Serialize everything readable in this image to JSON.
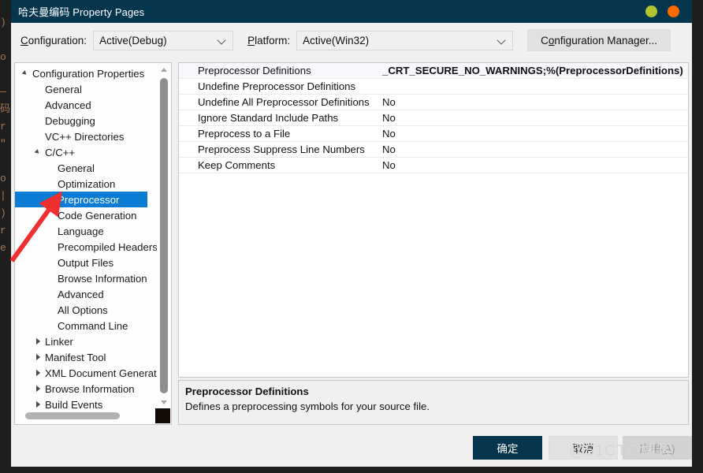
{
  "window": {
    "title": "哈夫曼编码 Property Pages",
    "controls": [
      {
        "name": "minimize-dot",
        "color": "#b3c42e"
      },
      {
        "name": "close-dot",
        "color": "#ff6a00"
      }
    ]
  },
  "toolbar": {
    "configuration_label": "Configuration:",
    "configuration_label_accel": "C",
    "configuration_value": "Active(Debug)",
    "platform_label": "Platform:",
    "platform_label_accel": "P",
    "platform_value": "Active(Win32)",
    "config_manager_label": "Configuration Manager...",
    "config_manager_accel": "o"
  },
  "tree": {
    "items": [
      {
        "label": "Configuration Properties",
        "indent": 0,
        "twisty": "expanded",
        "selected": false
      },
      {
        "label": "General",
        "indent": 1,
        "twisty": "none",
        "selected": false
      },
      {
        "label": "Advanced",
        "indent": 1,
        "twisty": "none",
        "selected": false
      },
      {
        "label": "Debugging",
        "indent": 1,
        "twisty": "none",
        "selected": false
      },
      {
        "label": "VC++ Directories",
        "indent": 1,
        "twisty": "none",
        "selected": false
      },
      {
        "label": "C/C++",
        "indent": 1,
        "twisty": "expanded",
        "selected": false
      },
      {
        "label": "General",
        "indent": 2,
        "twisty": "none",
        "selected": false
      },
      {
        "label": "Optimization",
        "indent": 2,
        "twisty": "none",
        "selected": false
      },
      {
        "label": "Preprocessor",
        "indent": 2,
        "twisty": "none",
        "selected": true
      },
      {
        "label": "Code Generation",
        "indent": 2,
        "twisty": "none",
        "selected": false
      },
      {
        "label": "Language",
        "indent": 2,
        "twisty": "none",
        "selected": false
      },
      {
        "label": "Precompiled Headers",
        "indent": 2,
        "twisty": "none",
        "selected": false
      },
      {
        "label": "Output Files",
        "indent": 2,
        "twisty": "none",
        "selected": false
      },
      {
        "label": "Browse Information",
        "indent": 2,
        "twisty": "none",
        "selected": false
      },
      {
        "label": "Advanced",
        "indent": 2,
        "twisty": "none",
        "selected": false
      },
      {
        "label": "All Options",
        "indent": 2,
        "twisty": "none",
        "selected": false
      },
      {
        "label": "Command Line",
        "indent": 2,
        "twisty": "none",
        "selected": false
      },
      {
        "label": "Linker",
        "indent": 1,
        "twisty": "collapsed",
        "selected": false
      },
      {
        "label": "Manifest Tool",
        "indent": 1,
        "twisty": "collapsed",
        "selected": false
      },
      {
        "label": "XML Document Generator",
        "indent": 1,
        "twisty": "collapsed",
        "selected": false
      },
      {
        "label": "Browse Information",
        "indent": 1,
        "twisty": "collapsed",
        "selected": false
      },
      {
        "label": "Build Events",
        "indent": 1,
        "twisty": "collapsed",
        "selected": false
      }
    ]
  },
  "grid": {
    "rows": [
      {
        "name": "Preprocessor Definitions",
        "value": "_CRT_SECURE_NO_WARNINGS;%(PreprocessorDefinitions)",
        "bold": true,
        "selected": true
      },
      {
        "name": "Undefine Preprocessor Definitions",
        "value": "",
        "bold": false,
        "selected": false
      },
      {
        "name": "Undefine All Preprocessor Definitions",
        "value": "No",
        "bold": false,
        "selected": false
      },
      {
        "name": "Ignore Standard Include Paths",
        "value": "No",
        "bold": false,
        "selected": false
      },
      {
        "name": "Preprocess to a File",
        "value": "No",
        "bold": false,
        "selected": false
      },
      {
        "name": "Preprocess Suppress Line Numbers",
        "value": "No",
        "bold": false,
        "selected": false
      },
      {
        "name": "Keep Comments",
        "value": "No",
        "bold": false,
        "selected": false
      }
    ]
  },
  "description": {
    "title": "Preprocessor Definitions",
    "body": "Defines a preprocessing symbols for your source file."
  },
  "footer": {
    "ok_label": "确定",
    "cancel_label": "取消",
    "apply_label": "应用(",
    "apply_accel": "A",
    "apply_label_tail": ")"
  },
  "annotation": {
    "arrow_color": "#f03030"
  },
  "watermark": {
    "text": "@51CTO博客"
  },
  "background": {
    "code_lines": [
      ")",
      "",
      "o",
      "",
      "—",
      "码",
      "r",
      "\"",
      "",
      "o",
      "|",
      ")",
      "r",
      "e"
    ]
  }
}
